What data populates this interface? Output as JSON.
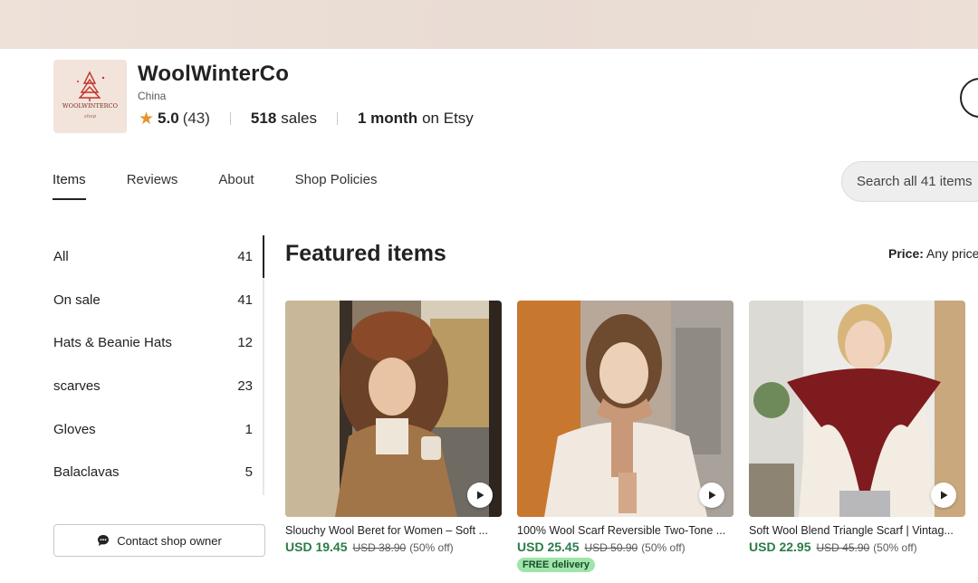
{
  "shop": {
    "logo_text": "WOOLWINTERCO",
    "logo_subtext": "shop",
    "name": "WoolWinterCo",
    "location": "China",
    "rating": "5.0",
    "rating_count": "(43)",
    "sales_count": "518",
    "sales_label": "sales",
    "tenure_value": "1 month",
    "tenure_label": "on Etsy"
  },
  "tabs": [
    {
      "label": "Items",
      "active": true
    },
    {
      "label": "Reviews"
    },
    {
      "label": "About"
    },
    {
      "label": "Shop Policies"
    }
  ],
  "search": {
    "placeholder": "Search all 41 items"
  },
  "sidebar": {
    "items": [
      {
        "label": "All",
        "count": "41"
      },
      {
        "label": "On sale",
        "count": "41"
      },
      {
        "label": "Hats & Beanie Hats",
        "count": "12"
      },
      {
        "label": "scarves",
        "count": "23"
      },
      {
        "label": "Gloves",
        "count": "1"
      },
      {
        "label": "Balaclavas",
        "count": "5"
      }
    ],
    "contact_label": "Contact shop owner"
  },
  "main": {
    "featured_title": "Featured items",
    "price_filter_label": "Price:",
    "price_filter_value": "Any price"
  },
  "products": [
    {
      "title": "Slouchy Wool Beret for Women – Soft ...",
      "price": "USD 19.45",
      "original_price": "USD 38.90",
      "discount": "(50% off)",
      "badge": ""
    },
    {
      "title": "100% Wool Scarf Reversible Two-Tone ...",
      "price": "USD 25.45",
      "original_price": "USD 50.90",
      "discount": "(50% off)",
      "badge": "FREE delivery"
    },
    {
      "title": "Soft Wool Blend Triangle Scarf | Vintag...",
      "price": "USD 22.95",
      "original_price": "USD 45.90",
      "discount": "(50% off)",
      "badge": ""
    }
  ],
  "colors": {
    "sale_price": "#2a7c48",
    "star": "#e3962b",
    "badge_bg": "#9ee5a9"
  }
}
